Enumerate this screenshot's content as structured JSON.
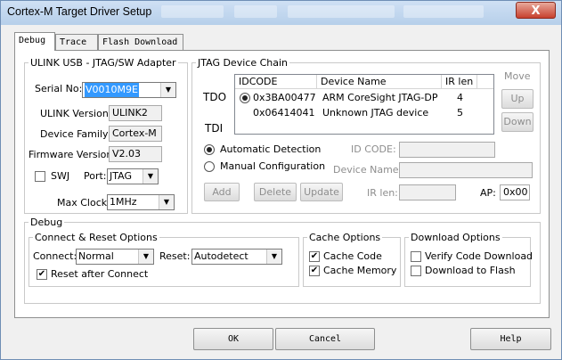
{
  "window": {
    "title": "Cortex-M Target Driver Setup",
    "close_label": "X"
  },
  "tabs": [
    {
      "label": "Debug"
    },
    {
      "label": "Trace"
    },
    {
      "label": "Flash Download"
    }
  ],
  "ulink": {
    "group_title": "ULINK USB - JTAG/SW Adapter",
    "serial_label": "Serial No:",
    "serial_value": "V0010M9E",
    "version_label": "ULINK Version:",
    "version_value": "ULINK2",
    "family_label": "Device Family:",
    "family_value": "Cortex-M",
    "firmware_label": "Firmware Version:",
    "firmware_value": "V2.03",
    "swj_label": "SWJ",
    "port_label": "Port:",
    "port_value": "JTAG",
    "maxclock_label": "Max Clock:",
    "maxclock_value": "1MHz"
  },
  "jtag": {
    "group_title": "JTAG Device Chain",
    "tdo_label": "TDO",
    "tdi_label": "TDI",
    "columns": [
      "IDCODE",
      "Device Name",
      "IR len"
    ],
    "rows": [
      {
        "idcode": "0x3BA00477",
        "name": "ARM CoreSight JTAG-DP",
        "irlen": "4",
        "selected": true
      },
      {
        "idcode": "0x06414041",
        "name": "Unknown JTAG device",
        "irlen": "5",
        "selected": false
      }
    ],
    "move_label": "Move",
    "up_label": "Up",
    "down_label": "Down",
    "auto_label": "Automatic Detection",
    "manual_label": "Manual Configuration",
    "idcode_label": "ID CODE:",
    "devname_label": "Device Name:",
    "irlen_label": "IR len:",
    "ap_label": "AP:",
    "ap_value": "0x00",
    "add_label": "Add",
    "delete_label": "Delete",
    "update_label": "Update"
  },
  "debug": {
    "group_title": "Debug",
    "connect_group": "Connect & Reset Options",
    "connect_label": "Connect:",
    "connect_value": "Normal",
    "reset_label": "Reset:",
    "reset_value": "Autodetect",
    "reset_after_label": "Reset after Connect",
    "cache_group": "Cache Options",
    "cache_code_label": "Cache Code",
    "cache_memory_label": "Cache Memory",
    "download_group": "Download Options",
    "verify_label": "Verify Code Download",
    "download_flash_label": "Download to Flash"
  },
  "footer": {
    "ok_label": "OK",
    "cancel_label": "Cancel",
    "help_label": "Help"
  }
}
